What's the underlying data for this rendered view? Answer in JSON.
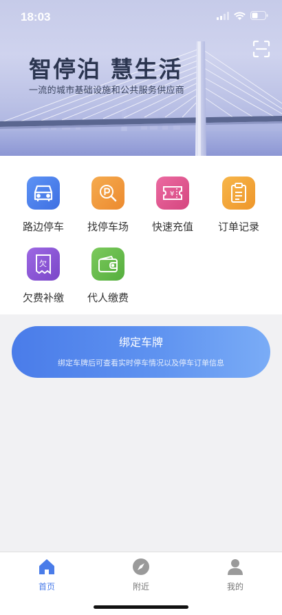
{
  "status_bar": {
    "time": "18:03"
  },
  "hero": {
    "title": "智停泊 慧生活",
    "subtitle": "一流的城市基础设施和公共服务供应商",
    "scan_icon": "scan-icon"
  },
  "services": [
    {
      "id": "roadside",
      "label": "路边停车",
      "icon": "car-icon",
      "color": "#4f83ee"
    },
    {
      "id": "find-lot",
      "label": "找停车场",
      "icon": "parking-search-icon",
      "color": "#f09a3c"
    },
    {
      "id": "recharge",
      "label": "快速充值",
      "icon": "yuan-ticket-icon",
      "color": "#e05a93"
    },
    {
      "id": "orders",
      "label": "订单记录",
      "icon": "clipboard-icon",
      "color": "#f3a535"
    },
    {
      "id": "arrears",
      "label": "欠费补缴",
      "icon": "arrears-receipt-icon",
      "color": "#8a55d6"
    },
    {
      "id": "pay-for-others",
      "label": "代人缴费",
      "icon": "wallet-icon",
      "color": "#68bd4e"
    }
  ],
  "bind_plate": {
    "title": "绑定车牌",
    "description": "绑定车牌后可查看实时停车情况以及停车订单信息"
  },
  "tabbar": {
    "active": "home",
    "items": [
      {
        "id": "home",
        "label": "首页",
        "icon": "home-icon"
      },
      {
        "id": "nearby",
        "label": "附近",
        "icon": "compass-icon"
      },
      {
        "id": "mine",
        "label": "我的",
        "icon": "user-icon"
      }
    ]
  },
  "colors": {
    "accent": "#4a7ce9",
    "page_bg": "#f1f1f3"
  }
}
